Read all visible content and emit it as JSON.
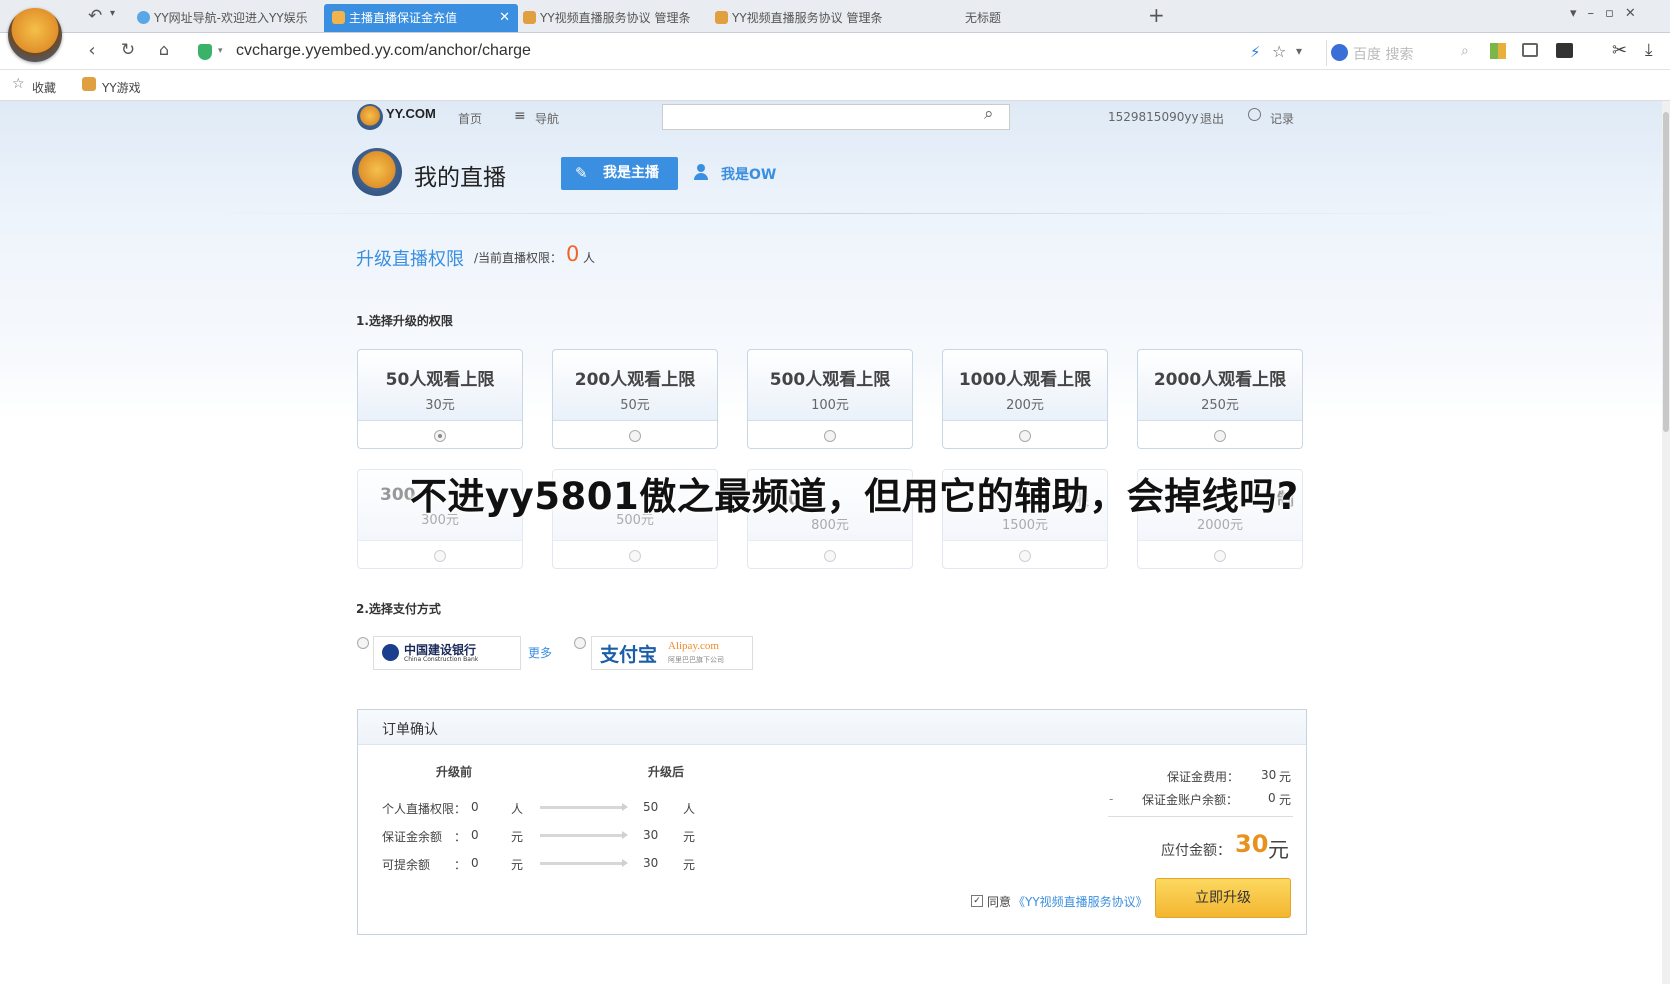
{
  "browser": {
    "tabs": [
      {
        "label": "YY网址导航-欢迎进入YY娱乐"
      },
      {
        "label": "主播直播保证金充值"
      },
      {
        "label": "YY视频直播服务协议 管理条"
      },
      {
        "label": "YY视频直播服务协议 管理条"
      },
      {
        "label": "无标题"
      }
    ],
    "new_tab": "+",
    "url": "cvcharge.yyembed.yy.com/anchor/charge",
    "search_placeholder": "百度 搜索",
    "bookmarks": [
      "收藏",
      "YY游戏"
    ]
  },
  "site_header": {
    "logo_text": "YY.COM",
    "home": "首页",
    "nav": "导航",
    "user": "1529815090yy",
    "logout": "退出",
    "history": "记录"
  },
  "main": {
    "title": "我的直播",
    "role_anchor": "我是主播",
    "role_ow": "我是OW",
    "upgrade_title": "升级直播权限",
    "current_label": "/当前直播权限：",
    "current_value": "0",
    "current_unit": "人",
    "step1": "1.选择升级的权限",
    "plans_row1": [
      {
        "title": "50人观看上限",
        "price": "30元"
      },
      {
        "title": "200人观看上限",
        "price": "50元"
      },
      {
        "title": "500人观看上限",
        "price": "100元"
      },
      {
        "title": "1000人观看上限",
        "price": "200元"
      },
      {
        "title": "2000人观看上限",
        "price": "250元"
      }
    ],
    "plans_row2": [
      {
        "title": "300",
        "price": "300元"
      },
      {
        "title": "",
        "price": "500元"
      },
      {
        "title": "0人",
        "price": "800元"
      },
      {
        "title": "上限",
        "price": "1500元"
      },
      {
        "title": "制",
        "price": "2000元"
      }
    ],
    "step2": "2.选择支付方式",
    "bank_name": "中国建设银行",
    "bank_en": "China Construction Bank",
    "more": "更多",
    "alipay_cn": "支付宝",
    "alipay_en": "Alipay.com",
    "alipay_sub": "阿里巴巴旗下公司"
  },
  "order": {
    "title": "订单确认",
    "before": "升级前",
    "after": "升级后",
    "rows": [
      {
        "label": "个人直播权限：",
        "before": "0",
        "unit": "人",
        "after": "50"
      },
      {
        "label": "保证金余额　：",
        "before": "0",
        "unit": "元",
        "after": "30"
      },
      {
        "label": "可提余额　　：",
        "before": "0",
        "unit": "元",
        "after": "30"
      }
    ],
    "fee_label": "保证金费用：",
    "fee_value": "30",
    "account_label": "保证金账户余额：",
    "account_value": "0",
    "yuan": "元",
    "minus": "-",
    "payable_label": "应付金额：",
    "payable_value": "30",
    "agree": "同意",
    "agreement": "《YY视频直播服务协议》",
    "submit": "立即升级"
  },
  "overlay_caption": "不进yy5801傲之最频道，但用它的辅助，会掉线吗?",
  "colors": {
    "accent": "#3b8fe0",
    "orange": "#f0642a",
    "button": "#f6c243"
  }
}
